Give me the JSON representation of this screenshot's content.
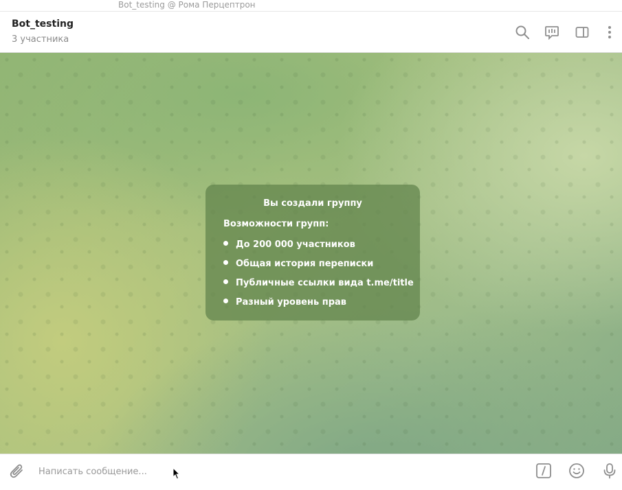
{
  "window": {
    "title": "Bot_testing @ Рома Перцептрон"
  },
  "header": {
    "title": "Bot_testing",
    "subtitle": "3 участника",
    "icons": [
      "search-icon",
      "video-chat-icon",
      "sidebar-toggle-icon",
      "more-icon"
    ]
  },
  "service_message": {
    "title": "Вы создали группу",
    "subtitle": "Возможности групп:",
    "features": [
      "До 200 000 участников",
      "Общая история переписки",
      "Публичные ссылки вида t.me/title",
      "Разный уровень прав"
    ]
  },
  "composer": {
    "placeholder": "Написать сообщение...",
    "icons": [
      "attach-icon",
      "bot-commands-icon",
      "emoji-icon",
      "microphone-icon"
    ]
  },
  "colors": {
    "accent_icons": "#8e8e8e",
    "card_bg": "rgba(95,130,75,0.72)",
    "wallpaper": "#9ebc7e"
  }
}
